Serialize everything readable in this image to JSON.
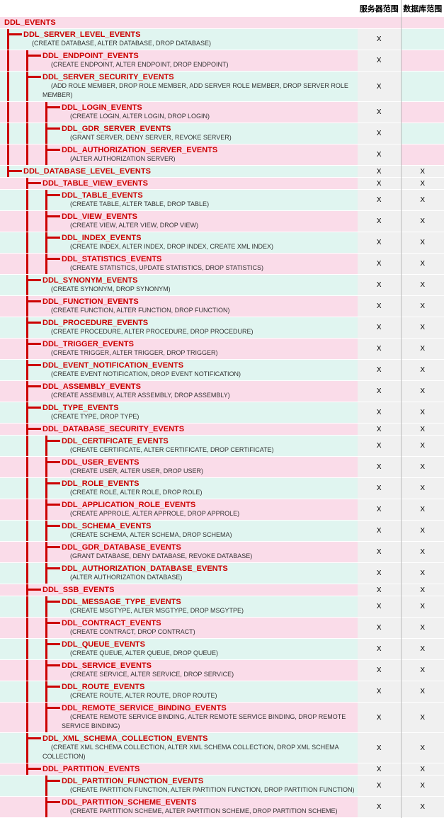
{
  "headers": {
    "server": "服务器范围",
    "database": "数据库范围"
  },
  "rows": [
    {
      "bg": "pink",
      "indent": 0,
      "title": "DDL_EVENTS",
      "sub": "",
      "srv": "",
      "db": "",
      "lines": []
    },
    {
      "bg": "cyan",
      "indent": 1,
      "title": "DDL_SERVER_LEVEL_EVENTS",
      "sub": "(CREATE DATABASE, ALTER DATABASE, DROP DATABASE)",
      "srv": "X",
      "db": "",
      "lines": [
        0
      ]
    },
    {
      "bg": "pink",
      "indent": 2,
      "title": "DDL_ENDPOINT_EVENTS",
      "sub": "(CREATE ENDPOINT, ALTER ENDPOINT, DROP ENDPOINT)",
      "srv": "X",
      "db": "",
      "lines": [
        0,
        1
      ]
    },
    {
      "bg": "cyan",
      "indent": 2,
      "title": "DDL_SERVER_SECURITY_EVENTS",
      "sub": "(ADD ROLE MEMBER, DROP ROLE MEMBER, ADD SERVER ROLE MEMBER, DROP SERVER ROLE MEMBER)",
      "srv": "X",
      "db": "",
      "lines": [
        0,
        1
      ]
    },
    {
      "bg": "pink",
      "indent": 3,
      "title": "DDL_LOGIN_EVENTS",
      "sub": "(CREATE LOGIN, ALTER LOGIN, DROP LOGIN)",
      "srv": "X",
      "db": "",
      "lines": [
        0,
        1,
        2
      ]
    },
    {
      "bg": "cyan",
      "indent": 3,
      "title": "DDL_GDR_SERVER_EVENTS",
      "sub": "(GRANT SERVER, DENY SERVER, REVOKE SERVER)",
      "srv": "X",
      "db": "",
      "lines": [
        0,
        1,
        2
      ]
    },
    {
      "bg": "pink",
      "indent": 3,
      "title": "DDL_AUTHORIZATION_SERVER_EVENTS",
      "sub": "(ALTER AUTHORIZATION SERVER)",
      "srv": "X",
      "db": "",
      "lines": [
        0,
        1,
        2
      ]
    },
    {
      "bg": "cyan",
      "indent": 1,
      "title": "DDL_DATABASE_LEVEL_EVENTS",
      "sub": "",
      "srv": "X",
      "db": "X",
      "lines": [
        0
      ]
    },
    {
      "bg": "pink",
      "indent": 2,
      "title": "DDL_TABLE_VIEW_EVENTS",
      "sub": "",
      "srv": "X",
      "db": "X",
      "lines": [
        1
      ]
    },
    {
      "bg": "cyan",
      "indent": 3,
      "title": "DDL_TABLE_EVENTS",
      "sub": "(CREATE TABLE, ALTER TABLE, DROP TABLE)",
      "srv": "X",
      "db": "X",
      "lines": [
        1,
        2
      ]
    },
    {
      "bg": "pink",
      "indent": 3,
      "title": "DDL_VIEW_EVENTS",
      "sub": "(CREATE VIEW, ALTER VIEW, DROP VIEW)",
      "srv": "X",
      "db": "X",
      "lines": [
        1,
        2
      ]
    },
    {
      "bg": "cyan",
      "indent": 3,
      "title": "DDL_INDEX_EVENTS",
      "sub": "(CREATE INDEX, ALTER INDEX, DROP INDEX, CREATE XML INDEX)",
      "srv": "X",
      "db": "X",
      "lines": [
        1,
        2
      ]
    },
    {
      "bg": "pink",
      "indent": 3,
      "title": "DDL_STATISTICS_EVENTS",
      "sub": "(CREATE STATISTICS, UPDATE STATISTICS, DROP STATISTICS)",
      "srv": "X",
      "db": "X",
      "lines": [
        1,
        2
      ]
    },
    {
      "bg": "cyan",
      "indent": 2,
      "title": "DDL_SYNONYM_EVENTS",
      "sub": "(CREATE SYNONYM, DROP SYNONYM)",
      "srv": "X",
      "db": "X",
      "lines": [
        1
      ]
    },
    {
      "bg": "pink",
      "indent": 2,
      "title": "DDL_FUNCTION_EVENTS",
      "sub": "(CREATE FUNCTION, ALTER FUNCTION, DROP FUNCTION)",
      "srv": "X",
      "db": "X",
      "lines": [
        1
      ]
    },
    {
      "bg": "cyan",
      "indent": 2,
      "title": "DDL_PROCEDURE_EVENTS",
      "sub": "(CREATE PROCEDURE, ALTER PROCEDURE, DROP PROCEDURE)",
      "srv": "X",
      "db": "X",
      "lines": [
        1
      ]
    },
    {
      "bg": "pink",
      "indent": 2,
      "title": "DDL_TRIGGER_EVENTS",
      "sub": "(CREATE TRIGGER, ALTER TRIGGER, DROP TRIGGER)",
      "srv": "X",
      "db": "X",
      "lines": [
        1
      ]
    },
    {
      "bg": "cyan",
      "indent": 2,
      "title": "DDL_EVENT_NOTIFICATION_EVENTS",
      "sub": "(CREATE EVENT NOTIFICATION, DROP EVENT NOTIFICATION)",
      "srv": "X",
      "db": "X",
      "lines": [
        1
      ]
    },
    {
      "bg": "pink",
      "indent": 2,
      "title": "DDL_ASSEMBLY_EVENTS",
      "sub": "(CREATE ASSEMBLY, ALTER ASSEMBLY, DROP ASSEMBLY)",
      "srv": "X",
      "db": "X",
      "lines": [
        1
      ]
    },
    {
      "bg": "cyan",
      "indent": 2,
      "title": "DDL_TYPE_EVENTS",
      "sub": "(CREATE TYPE, DROP TYPE)",
      "srv": "X",
      "db": "X",
      "lines": [
        1
      ]
    },
    {
      "bg": "pink",
      "indent": 2,
      "title": "DDL_DATABASE_SECURITY_EVENTS",
      "sub": "",
      "srv": "X",
      "db": "X",
      "lines": [
        1
      ]
    },
    {
      "bg": "cyan",
      "indent": 3,
      "title": "DDL_CERTIFICATE_EVENTS",
      "sub": "(CREATE CERTIFICATE, ALTER CERTIFICATE, DROP CERTIFICATE)",
      "srv": "X",
      "db": "X",
      "lines": [
        1,
        2
      ]
    },
    {
      "bg": "pink",
      "indent": 3,
      "title": "DDL_USER_EVENTS",
      "sub": "(CREATE USER, ALTER USER, DROP USER)",
      "srv": "X",
      "db": "X",
      "lines": [
        1,
        2
      ]
    },
    {
      "bg": "cyan",
      "indent": 3,
      "title": "DDL_ROLE_EVENTS",
      "sub": "(CREATE ROLE, ALTER ROLE, DROP ROLE)",
      "srv": "X",
      "db": "X",
      "lines": [
        1,
        2
      ]
    },
    {
      "bg": "pink",
      "indent": 3,
      "title": "DDL_APPLICATION_ROLE_EVENTS",
      "sub": "(CREATE APPROLE, ALTER APPROLE, DROP APPROLE)",
      "srv": "X",
      "db": "X",
      "lines": [
        1,
        2
      ]
    },
    {
      "bg": "cyan",
      "indent": 3,
      "title": "DDL_SCHEMA_EVENTS",
      "sub": "(CREATE SCHEMA, ALTER SCHEMA, DROP SCHEMA)",
      "srv": "X",
      "db": "X",
      "lines": [
        1,
        2
      ]
    },
    {
      "bg": "pink",
      "indent": 3,
      "title": "DDL_GDR_DATABASE_EVENTS",
      "sub": "(GRANT DATABASE, DENY DATABASE, REVOKE DATABASE)",
      "srv": "X",
      "db": "X",
      "lines": [
        1,
        2
      ]
    },
    {
      "bg": "cyan",
      "indent": 3,
      "title": "DDL_AUTHORIZATION_DATABASE_EVENTS",
      "sub": "(ALTER AUTHORIZATION DATABASE)",
      "srv": "X",
      "db": "X",
      "lines": [
        1,
        2
      ]
    },
    {
      "bg": "pink",
      "indent": 2,
      "title": "DDL_SSB_EVENTS",
      "sub": "",
      "srv": "X",
      "db": "X",
      "lines": [
        1
      ]
    },
    {
      "bg": "cyan",
      "indent": 3,
      "title": "DDL_MESSAGE_TYPE_EVENTS",
      "sub": "(CREATE MSGTYPE, ALTER MSGTYPE, DROP MSGYTPE)",
      "srv": "X",
      "db": "X",
      "lines": [
        1,
        2
      ]
    },
    {
      "bg": "pink",
      "indent": 3,
      "title": "DDL_CONTRACT_EVENTS",
      "sub": "(CREATE CONTRACT, DROP CONTRACT)",
      "srv": "X",
      "db": "X",
      "lines": [
        1,
        2
      ]
    },
    {
      "bg": "cyan",
      "indent": 3,
      "title": "DDL_QUEUE_EVENTS",
      "sub": "(CREATE QUEUE, ALTER QUEUE, DROP QUEUE)",
      "srv": "X",
      "db": "X",
      "lines": [
        1,
        2
      ]
    },
    {
      "bg": "pink",
      "indent": 3,
      "title": "DDL_SERVICE_EVENTS",
      "sub": "(CREATE SERVICE, ALTER SERVICE, DROP SERVICE)",
      "srv": "X",
      "db": "X",
      "lines": [
        1,
        2
      ]
    },
    {
      "bg": "cyan",
      "indent": 3,
      "title": "DDL_ROUTE_EVENTS",
      "sub": "(CREATE ROUTE, ALTER ROUTE, DROP ROUTE)",
      "srv": "X",
      "db": "X",
      "lines": [
        1,
        2
      ]
    },
    {
      "bg": "pink",
      "indent": 3,
      "title": "DDL_REMOTE_SERVICE_BINDING_EVENTS",
      "sub": "(CREATE REMOTE SERVICE BINDING, ALTER REMOTE SERVICE BINDING, DROP REMOTE SERVICE BINDING)",
      "srv": "X",
      "db": "X",
      "lines": [
        1,
        2
      ]
    },
    {
      "bg": "cyan",
      "indent": 2,
      "title": "DDL_XML_SCHEMA_COLLECTION_EVENTS",
      "sub": "(CREATE XML SCHEMA COLLECTION, ALTER XML SCHEMA COLLECTION, DROP XML SCHEMA COLLECTION)",
      "srv": "X",
      "db": "X",
      "lines": [
        1
      ]
    },
    {
      "bg": "pink",
      "indent": 2,
      "title": "DDL_PARTITION_EVENTS",
      "sub": "",
      "srv": "X",
      "db": "X",
      "lines": [
        1
      ]
    },
    {
      "bg": "cyan",
      "indent": 3,
      "title": "DDL_PARTITION_FUNCTION_EVENTS",
      "sub": "(CREATE PARTITION FUNCTION, ALTER PARTITION FUNCTION, DROP PARTITION FUNCTION)",
      "srv": "X",
      "db": "X",
      "lines": [
        2
      ]
    },
    {
      "bg": "pink",
      "indent": 3,
      "title": "DDL_PARTITION_SCHEME_EVENTS",
      "sub": "(CREATE PARTITION SCHEME, ALTER PARTITION SCHEME, DROP PARTITION SCHEME)",
      "srv": "X",
      "db": "X",
      "lines": [
        2
      ]
    }
  ]
}
